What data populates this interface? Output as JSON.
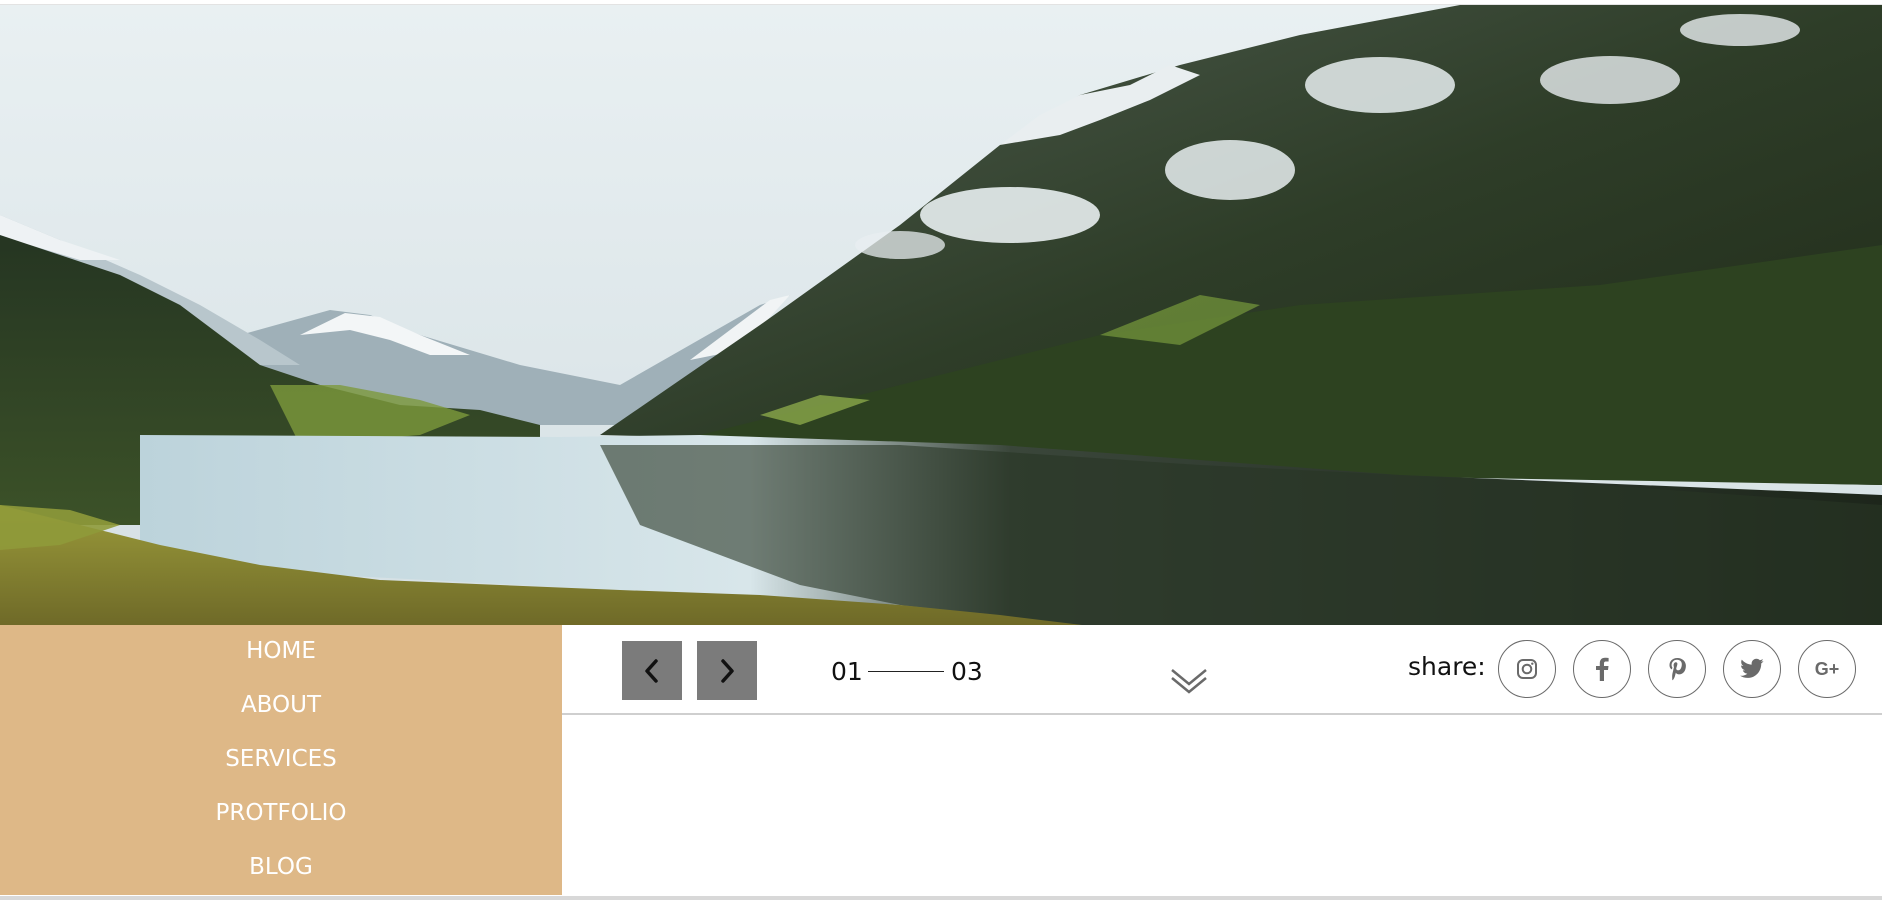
{
  "hero": {
    "icon": "landscape-lake-mountains-image"
  },
  "menu": {
    "items": [
      {
        "label": "HOME"
      },
      {
        "label": "ABOUT"
      },
      {
        "label": "SERVICES"
      },
      {
        "label": "PROTFOLIO"
      },
      {
        "label": "BLOG"
      }
    ],
    "background": "#deb887"
  },
  "slider": {
    "prev_icon": "chevron-left-icon",
    "next_icon": "chevron-right-icon",
    "current": "01",
    "total": "03",
    "scroll_icon": "double-chevron-down-icon"
  },
  "share": {
    "label": "share:",
    "networks": [
      {
        "name": "instagram",
        "icon": "instagram-icon"
      },
      {
        "name": "facebook",
        "icon": "facebook-icon"
      },
      {
        "name": "pinterest",
        "icon": "pinterest-icon"
      },
      {
        "name": "twitter",
        "icon": "twitter-icon"
      },
      {
        "name": "google-plus",
        "icon": "google-plus-icon",
        "glyph": "G+"
      }
    ]
  },
  "colors": {
    "button": "#7b7b7b",
    "icon_stroke": "#6a6a6a"
  }
}
